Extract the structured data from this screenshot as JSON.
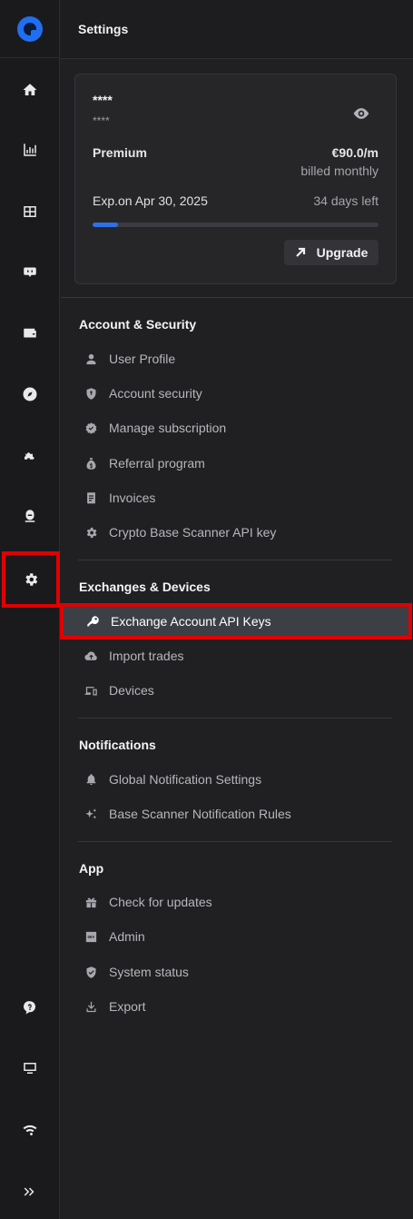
{
  "header": {
    "title": "Settings"
  },
  "rail": {
    "items": [
      {
        "icon": "home-icon"
      },
      {
        "icon": "chart-icon"
      },
      {
        "icon": "grid-icon"
      },
      {
        "icon": "bot-icon"
      },
      {
        "icon": "wallet-icon"
      },
      {
        "icon": "compass-icon"
      },
      {
        "icon": "puzzle-icon"
      },
      {
        "icon": "support-icon"
      },
      {
        "icon": "gear-icon",
        "active": true
      }
    ],
    "bottom": [
      {
        "icon": "help-icon"
      },
      {
        "icon": "monitor-icon"
      },
      {
        "icon": "wifi-icon"
      },
      {
        "icon": "expand-icon"
      }
    ]
  },
  "account_card": {
    "masked_name": "****",
    "masked_email": "****",
    "plan": "Premium",
    "price": "€90.0/m",
    "billing": "billed monthly",
    "expiry": "Exp.on Apr 30, 2025",
    "days_left": "34 days left",
    "progress": 0.09,
    "upgrade_label": "Upgrade"
  },
  "sections": {
    "account": {
      "title": "Account & Security",
      "items": [
        {
          "label": "User Profile",
          "icon": "user-icon"
        },
        {
          "label": "Account security",
          "icon": "shield-icon"
        },
        {
          "label": "Manage subscription",
          "icon": "verified-icon"
        },
        {
          "label": "Referral program",
          "icon": "money-bag-icon"
        },
        {
          "label": "Invoices",
          "icon": "receipt-icon"
        },
        {
          "label": "Crypto Base Scanner API key",
          "icon": "gear-icon"
        }
      ]
    },
    "exchanges": {
      "title": "Exchanges & Devices",
      "items": [
        {
          "label": "Exchange Account API Keys",
          "icon": "key-icon",
          "selected": true
        },
        {
          "label": "Import trades",
          "icon": "cloud-upload-icon"
        },
        {
          "label": "Devices",
          "icon": "devices-icon"
        }
      ]
    },
    "notifications": {
      "title": "Notifications",
      "items": [
        {
          "label": "Global Notification Settings",
          "icon": "bell-icon"
        },
        {
          "label": "Base Scanner Notification Rules",
          "icon": "sparkle-icon"
        }
      ]
    },
    "app": {
      "title": "App",
      "items": [
        {
          "label": "Check for updates",
          "icon": "gift-icon"
        },
        {
          "label": "Admin",
          "icon": "dev-icon"
        },
        {
          "label": "System status",
          "icon": "shield-check-icon"
        },
        {
          "label": "Export",
          "icon": "download-icon"
        }
      ]
    }
  },
  "colors": {
    "accent": "#2f6fe8",
    "highlight": "#e00000"
  }
}
